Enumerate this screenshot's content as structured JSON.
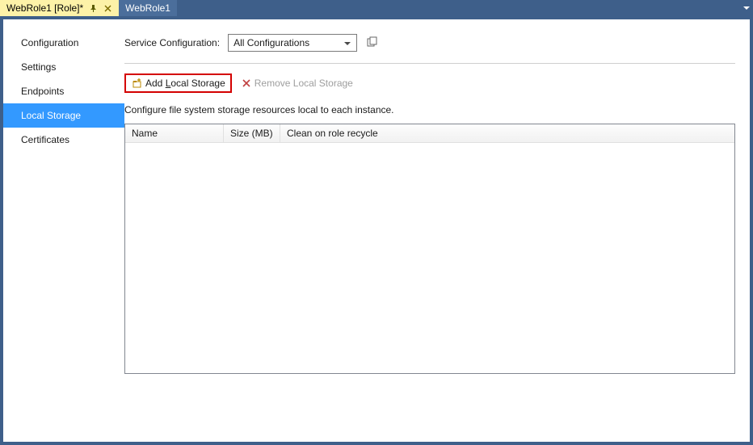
{
  "tabs": {
    "active": "WebRole1 [Role]*",
    "inactive": "WebRole1"
  },
  "sidebar": {
    "items": [
      {
        "label": "Configuration"
      },
      {
        "label": "Settings"
      },
      {
        "label": "Endpoints"
      },
      {
        "label": "Local Storage"
      },
      {
        "label": "Certificates"
      }
    ],
    "selected_index": 3
  },
  "config_row": {
    "label": "Service Configuration:",
    "selected": "All Configurations"
  },
  "toolbar": {
    "add_prefix": "Add ",
    "add_hotkey": "L",
    "add_suffix": "ocal Storage",
    "remove_label": "Remove Local Storage"
  },
  "description": "Configure file system storage resources local to each instance.",
  "grid": {
    "columns": [
      "Name",
      "Size (MB)",
      "Clean on role recycle"
    ]
  }
}
